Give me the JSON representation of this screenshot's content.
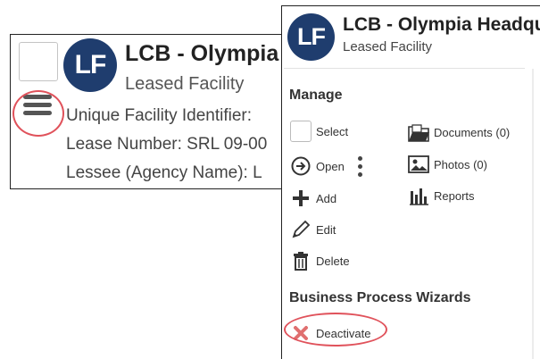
{
  "left_panel": {
    "avatar_initials": "LF",
    "title": "LCB - Olympia Headquarters",
    "subtitle": "Leased Facility",
    "fields": [
      "Unique Facility Identifier: ",
      "Lease Number: SRL 09-00",
      "Lessee (Agency Name): L"
    ]
  },
  "right_panel": {
    "avatar_initials": "LF",
    "title": "LCB - Olympia Headquarters",
    "subtitle": "Leased Facility",
    "manage_heading": "Manage",
    "manage_items": {
      "select": "Select",
      "open": "Open",
      "add": "Add",
      "edit": "Edit",
      "delete": "Delete",
      "documents": "Documents (0)",
      "photos": "Photos (0)",
      "reports": "Reports"
    },
    "wizards_heading": "Business Process Wizards",
    "deactivate": "Deactivate"
  },
  "colors": {
    "avatar": "#1f3d6e",
    "highlight_circle": "#e0525b",
    "deactivate_icon": "#e07070"
  }
}
